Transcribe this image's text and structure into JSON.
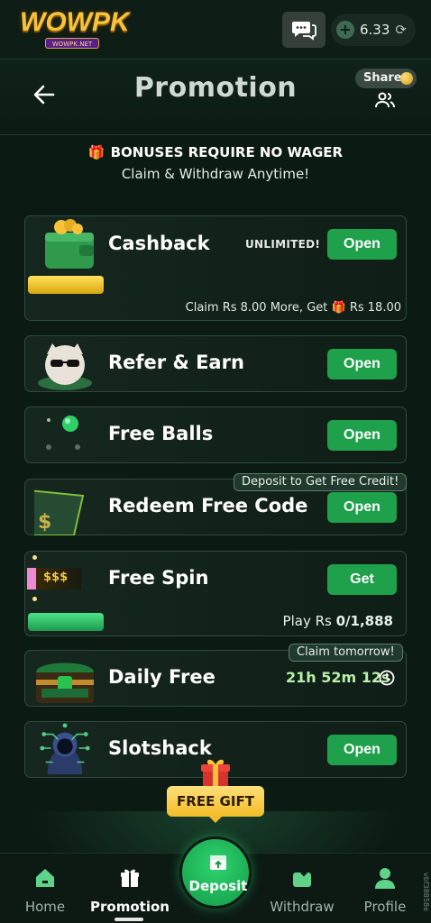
{
  "header": {
    "logo_text": "WOWPK",
    "logo_sub": "WOWPK.NET",
    "balance": "6.33"
  },
  "page": {
    "title": "Promotion",
    "share_label": "Share"
  },
  "bonus": {
    "headline": "BONUSES REQUIRE NO WAGER",
    "subline": "Claim & Withdraw Anytime!"
  },
  "cards": {
    "cashback": {
      "title": "Cashback",
      "badge": "UNLIMITED!",
      "button": "Open",
      "claim_text_pre": "Claim Rs 8.00 More, Get",
      "claim_text_post": "Rs 18.00",
      "progress": 0.0
    },
    "refer": {
      "title": "Refer & Earn",
      "button": "Open"
    },
    "balls": {
      "title": "Free Balls",
      "button": "Open"
    },
    "redeem": {
      "title": "Redeem Free Code",
      "button": "Open",
      "tag": "Deposit to Get Free Credit!"
    },
    "spin": {
      "title": "Free Spin",
      "button": "Get",
      "icon_text": "$$$",
      "play_prefix": "Play Rs",
      "play_value": "0/1,888"
    },
    "daily": {
      "title": "Daily Free",
      "tag": "Claim tomorrow!",
      "timer": "21h 52m 12s"
    },
    "slotshack": {
      "title": "Slotshack",
      "button": "Open"
    }
  },
  "free_gift": "FREE GIFT",
  "nav": {
    "home": "Home",
    "promotion": "Promotion",
    "deposit": "Deposit",
    "withdraw": "Withdraw",
    "profile": "Profile"
  },
  "version": "vbf38858e"
}
